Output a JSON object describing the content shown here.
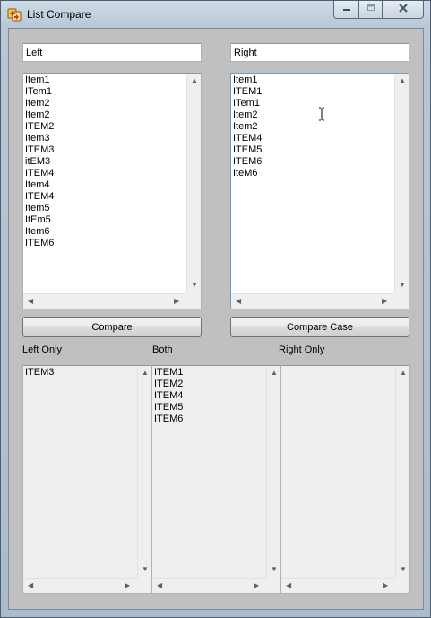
{
  "window": {
    "title": "List Compare",
    "icon": "list-compare-app-icon",
    "controls": [
      "minimize-icon",
      "maximize-icon",
      "close-icon"
    ]
  },
  "left": {
    "input_value": "Left",
    "items": [
      "Item1",
      "ITem1",
      "Item2",
      "Item2",
      "ITEM2",
      "Item3",
      "ITEM3",
      "itEM3",
      "ITEM4",
      "Item4",
      "ITEM4",
      "Item5",
      "ItEm5",
      "Item6",
      "ITEM6"
    ]
  },
  "right": {
    "input_value": "Right",
    "items": [
      "Item1",
      "ITEM1",
      "ITem1",
      "Item2",
      "Item2",
      "ITEM4",
      "ITEM5",
      "ITEM6",
      "IteM6"
    ]
  },
  "buttons": {
    "compare": "Compare",
    "compare_case": "Compare Case"
  },
  "results": {
    "left_only_label": "Left Only",
    "both_label": "Both",
    "right_only_label": "Right Only",
    "left_only": [
      "ITEM3"
    ],
    "both": [
      "ITEM1",
      "ITEM2",
      "ITEM4",
      "ITEM5",
      "ITEM6"
    ],
    "right_only": []
  },
  "colors": {
    "window_frame": "#b8c7d6",
    "client_bg": "#c0c0c0",
    "readonly_list_bg": "#efefef"
  }
}
